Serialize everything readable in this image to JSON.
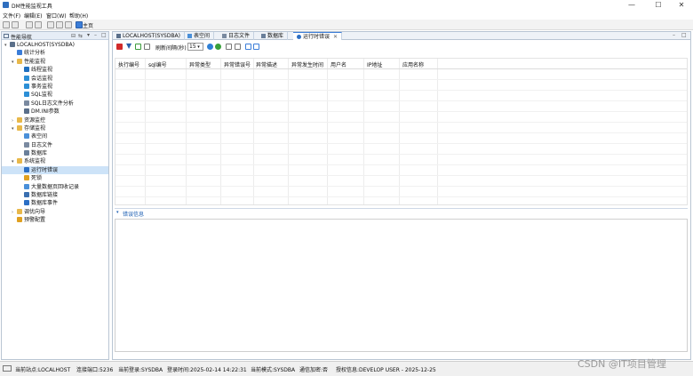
{
  "window": {
    "title": "DM性能监视工具",
    "controls": [
      "—",
      "☐",
      "✕"
    ]
  },
  "menu": [
    "文件(F)",
    "编辑(E)",
    "窗口(W)",
    "帮助(H)"
  ],
  "toolbar": {
    "home_label": "主页"
  },
  "left_panel": {
    "title": "性能导航",
    "tree": [
      {
        "label": "LOCALHOST(SYSDBA)",
        "level": 0,
        "arrow": "▾",
        "icon": "server-icon",
        "color": "#5a6f8a"
      },
      {
        "label": "统计分析",
        "level": 1,
        "arrow": "",
        "icon": "stats-icon",
        "color": "#3b7dd8"
      },
      {
        "label": "性能监视",
        "level": 1,
        "arrow": "▾",
        "icon": "folder-icon",
        "color": "#e8b84a"
      },
      {
        "label": "线程监视",
        "level": 2,
        "arrow": "",
        "icon": "thread-icon",
        "color": "#1f6fbf"
      },
      {
        "label": "会话监视",
        "level": 2,
        "arrow": "",
        "icon": "session-icon",
        "color": "#2c8fd6"
      },
      {
        "label": "事务监视",
        "level": 2,
        "arrow": "",
        "icon": "transaction-icon",
        "color": "#2c8fd6"
      },
      {
        "label": "SQL监视",
        "level": 2,
        "arrow": "",
        "icon": "sql-icon",
        "color": "#2c8fd6"
      },
      {
        "label": "SQL日志文件分析",
        "level": 2,
        "arrow": "",
        "icon": "log-icon",
        "color": "#7a8aa0"
      },
      {
        "label": "DM.INI参数",
        "level": 2,
        "arrow": "",
        "icon": "ini-icon",
        "color": "#5a6f8a"
      },
      {
        "label": "资源监控",
        "level": 1,
        "arrow": "›",
        "icon": "folder-icon",
        "color": "#e8b84a"
      },
      {
        "label": "存储监视",
        "level": 1,
        "arrow": "▾",
        "icon": "folder-icon",
        "color": "#e8b84a"
      },
      {
        "label": "表空间",
        "level": 2,
        "arrow": "",
        "icon": "tablespace-icon",
        "color": "#4a90d9"
      },
      {
        "label": "日志文件",
        "level": 2,
        "arrow": "",
        "icon": "logfile-icon",
        "color": "#7a8aa0"
      },
      {
        "label": "数据库",
        "level": 2,
        "arrow": "",
        "icon": "database-icon",
        "color": "#6a7f9a"
      },
      {
        "label": "系统监视",
        "level": 1,
        "arrow": "▾",
        "icon": "folder-icon",
        "color": "#e8b84a"
      },
      {
        "label": "运行时错误",
        "level": 2,
        "arrow": "",
        "icon": "error-icon",
        "color": "#2c6fc4",
        "selected": true
      },
      {
        "label": "死锁",
        "level": 2,
        "arrow": "",
        "icon": "lock-icon",
        "color": "#e0a020"
      },
      {
        "label": "大量数据页回收记录",
        "level": 2,
        "arrow": "",
        "icon": "page-icon",
        "color": "#4a90d9"
      },
      {
        "label": "数据库链接",
        "level": 2,
        "arrow": "",
        "icon": "link-icon",
        "color": "#3a6fb0"
      },
      {
        "label": "数据库事件",
        "level": 2,
        "arrow": "",
        "icon": "event-icon",
        "color": "#2c6fc4"
      },
      {
        "label": "调优向导",
        "level": 1,
        "arrow": "›",
        "icon": "folder-icon",
        "color": "#e8b84a"
      },
      {
        "label": "预警配置",
        "level": 1,
        "arrow": "",
        "icon": "alert-icon",
        "color": "#e0a020"
      }
    ]
  },
  "tabs": [
    {
      "label": "LOCALHOST(SYSDBA)",
      "icon": "server-icon"
    },
    {
      "label": "表空间",
      "icon": "tablespace-icon"
    },
    {
      "label": "日志文件",
      "icon": "logfile-icon"
    },
    {
      "label": "数据库",
      "icon": "database-icon"
    },
    {
      "label": "运行时错误",
      "icon": "error-icon",
      "active": true
    }
  ],
  "subtoolbar": {
    "refresh_label": "刷新间隔(秒)",
    "refresh_value": "15"
  },
  "table": {
    "columns": [
      "执行编号",
      "sql编号",
      "异常类型",
      "异常错误号",
      "异常描述",
      "异常发生时间",
      "用户名",
      "IP地址",
      "应用名称"
    ]
  },
  "error_panel": {
    "label": "错误信息"
  },
  "status": [
    "当前站点:LOCALHOST",
    "连接端口:5236",
    "当前登录:SYSDBA",
    "登录时间:2025-02-14 14:22:31",
    "当前模式:SYSDBA",
    "通信加密:否",
    "授权信息:DEVELOP USER - 2025-12-25"
  ],
  "watermark": "CSDN @IT项目管理"
}
